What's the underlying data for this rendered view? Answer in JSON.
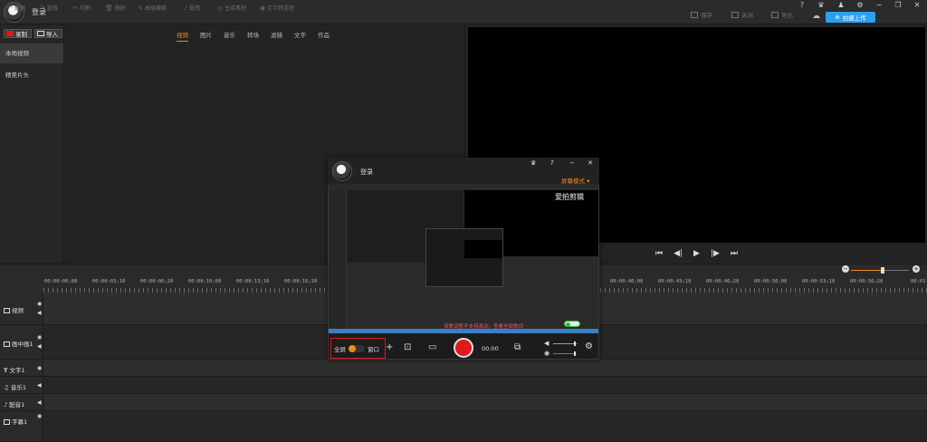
{
  "app": {
    "username": "登录"
  },
  "topbar": {
    "save": "保存",
    "close": "关闭",
    "export": "导出",
    "upload": "拍摄上传",
    "help": "?",
    "minimize": "−",
    "maximize": "❐",
    "close_window": "✕"
  },
  "left": {
    "record_label": "录制",
    "import_label": "导入",
    "sidebar": [
      "本地视频",
      "精美片头"
    ],
    "tabs": [
      "视频",
      "图片",
      "音乐",
      "转场",
      "滤镜",
      "文字",
      "作品"
    ],
    "active_tab": "视频"
  },
  "toolbar": {
    "items": [
      "撤销",
      "重做",
      "切割",
      "删除",
      "高级编辑",
      "配音",
      "生成素材",
      "文字转语音"
    ]
  },
  "ruler": {
    "timecodes": [
      "00:00:00;00",
      "00:00:03;10",
      "00:00:06;20",
      "00:00:10;00",
      "00:00:13;10",
      "00:00:16;20",
      "00:00:40;00",
      "00:00:43;10",
      "00:00:46;20",
      "00:00:50;00",
      "00:00:53;10",
      "00:00:56;20",
      "00:01"
    ]
  },
  "tracks": [
    {
      "name": "视频"
    },
    {
      "name": "画中画1"
    },
    {
      "name": "文字1"
    },
    {
      "name": "音乐1"
    },
    {
      "name": "配音1"
    },
    {
      "name": "字幕1"
    }
  ],
  "recorder": {
    "title": "登录",
    "mode": "屏幕模式 ▾",
    "hint": "该歌词暂不支持滚动，查看全部歌词",
    "fullscreen": "全屏",
    "window": "窗口",
    "time": "00:00",
    "watermark": "爱拍剪辑"
  }
}
